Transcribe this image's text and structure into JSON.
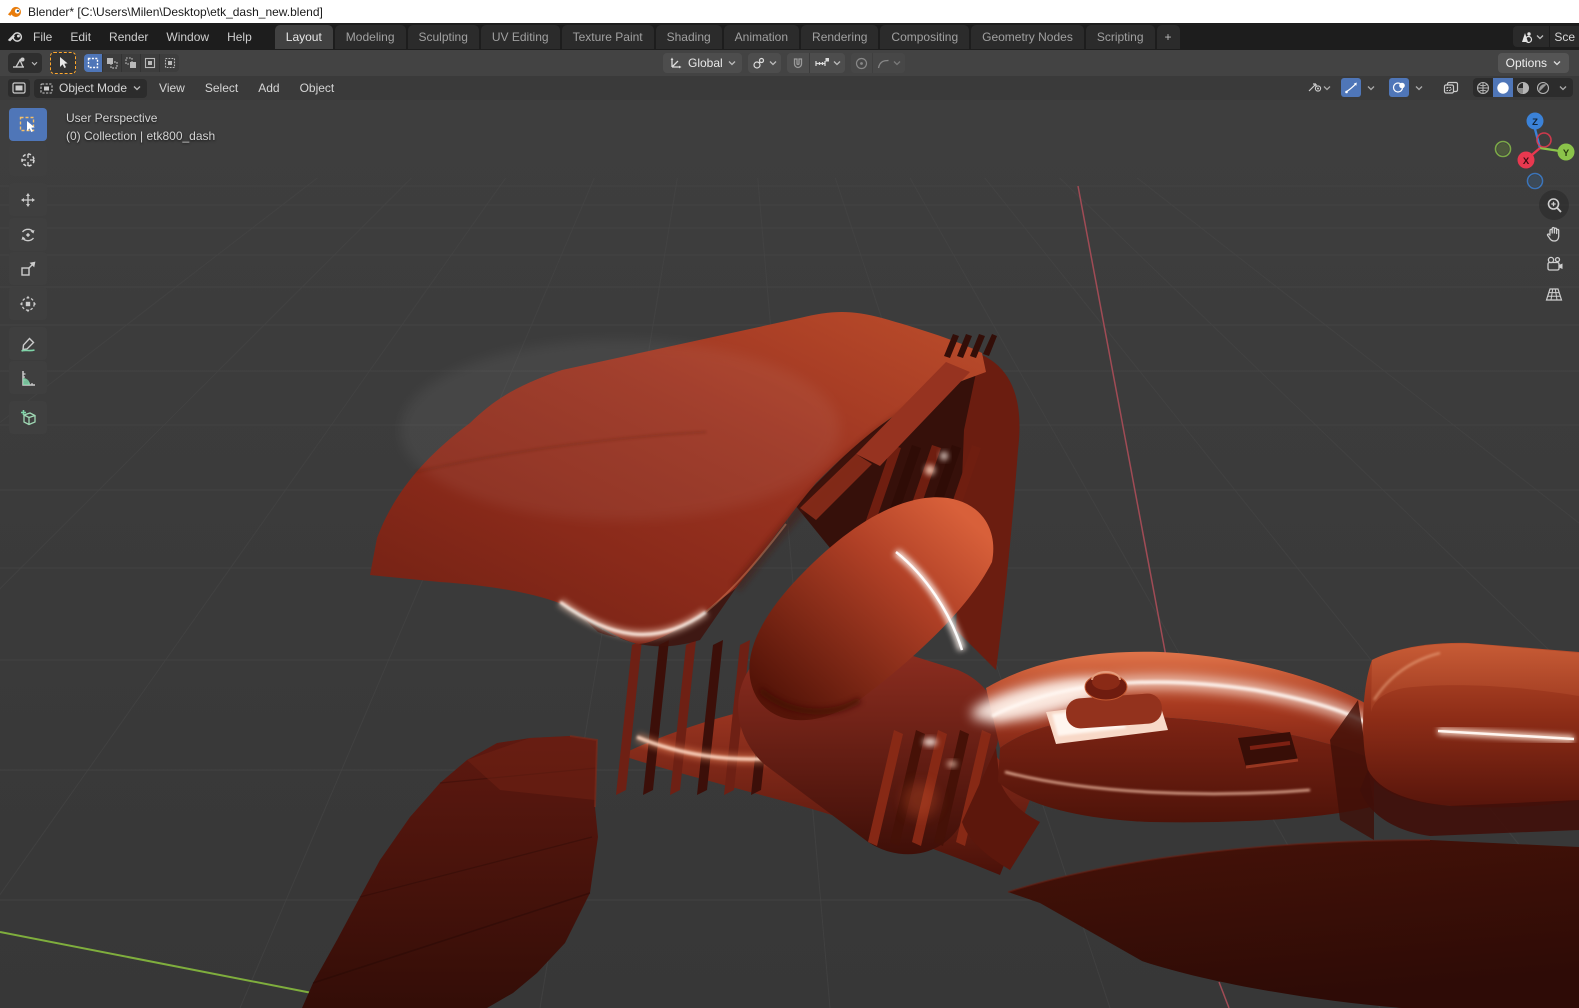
{
  "window": {
    "title": "Blender* [C:\\Users\\Milen\\Desktop\\etk_dash_new.blend]"
  },
  "topbar": {
    "menus": [
      "File",
      "Edit",
      "Render",
      "Window",
      "Help"
    ],
    "workspaces": [
      {
        "label": "Layout",
        "active": true
      },
      {
        "label": "Modeling",
        "active": false
      },
      {
        "label": "Sculpting",
        "active": false
      },
      {
        "label": "UV Editing",
        "active": false
      },
      {
        "label": "Texture Paint",
        "active": false
      },
      {
        "label": "Shading",
        "active": false
      },
      {
        "label": "Animation",
        "active": false
      },
      {
        "label": "Rendering",
        "active": false
      },
      {
        "label": "Compositing",
        "active": false
      },
      {
        "label": "Geometry Nodes",
        "active": false
      },
      {
        "label": "Scripting",
        "active": false
      }
    ],
    "add_workspace_label": "+",
    "scene_selector": {
      "visible_text": "Sce"
    }
  },
  "tool_settings": {
    "orientation": "Global",
    "options_label": "Options",
    "selection_modes": [
      "new",
      "extend",
      "subtract",
      "invert",
      "intersect"
    ],
    "active_selection_mode": "new",
    "active_tool": "select-box"
  },
  "viewport_header": {
    "mode": "Object Mode",
    "menus": [
      "View",
      "Select",
      "Add",
      "Object"
    ],
    "toggles": {
      "gizmos_on": true,
      "overlays_on": true,
      "shading_active": "solid"
    }
  },
  "viewport": {
    "overlay_line1": "User Perspective",
    "overlay_line2": "(0) Collection | etk800_dash",
    "gizmo_axes": {
      "x": "X",
      "y": "Y",
      "z": "Z"
    },
    "model_name": "etk800_dash"
  },
  "toolbar_tools": [
    "select-box",
    "cursor",
    "move",
    "rotate",
    "scale",
    "transform",
    "annotate",
    "measure",
    "add-cube"
  ],
  "colors": {
    "titlebar-bg": "#ffffff",
    "topbar-bg": "#1d1d1d",
    "toolrow-bg": "#434343",
    "header-bg": "#3a3a3a",
    "vp-bg": "#3b3b3b",
    "accent-blue": "#4f76b8",
    "tool-orange": "#ffa82e",
    "grid": "#474747",
    "axis-x": "#e8384f",
    "axis-y": "#8bc34a",
    "axis-z": "#3b82d8",
    "model-red": "#9c3421",
    "model-dark": "#3a0f0a",
    "specular": "#fff3ec",
    "blender-logo-orange": "#e87d0d"
  }
}
